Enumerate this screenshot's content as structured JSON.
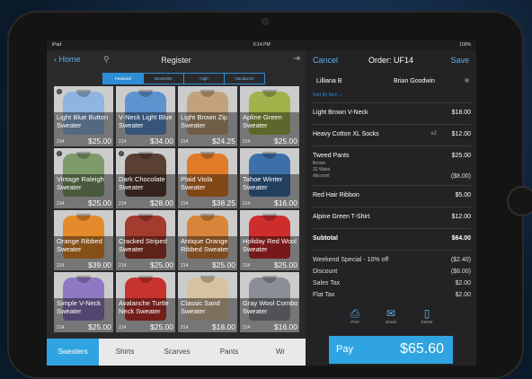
{
  "status": {
    "carrier": "iPad",
    "time": "6:14 PM",
    "battery": "100%"
  },
  "left_nav": {
    "home": "Home",
    "title": "Register"
  },
  "segments": [
    "Featured",
    "Bestseller",
    "High",
    "Handiwork"
  ],
  "products": [
    {
      "name": "Light Blue Button Sweater",
      "qty": "214",
      "price": "$25.00",
      "color": "#8fb4de",
      "info": true
    },
    {
      "name": "V-Neck Light Blue Sweater",
      "qty": "214",
      "price": "$34.00",
      "color": "#5d93cf"
    },
    {
      "name": "Light Brown Zip Sweater",
      "qty": "214",
      "price": "$24.25",
      "color": "#c2a27c"
    },
    {
      "name": "Apline Green Sweater",
      "qty": "214",
      "price": "$25.00",
      "color": "#9fb34a"
    },
    {
      "name": "Vintage Raleigh Sweater",
      "qty": "214",
      "price": "$25.00",
      "color": "#7e9a69",
      "info": true
    },
    {
      "name": "Dark Chocolate Sweater",
      "qty": "214",
      "price": "$28.00",
      "color": "#5a3f33",
      "info": true
    },
    {
      "name": "Plaid Viola Sweater",
      "qty": "214",
      "price": "$38.25",
      "color": "#e07b28"
    },
    {
      "name": "Tahoe Winter Sweater",
      "qty": "214",
      "price": "$16.00",
      "color": "#3d6fa8"
    },
    {
      "name": "Orange Ribbed Sweater",
      "qty": "214",
      "price": "$39.00",
      "color": "#e48a2a"
    },
    {
      "name": "Cracked Striped Sweater",
      "qty": "214",
      "price": "$25.00",
      "color": "#a33b2e"
    },
    {
      "name": "Antique Orange Ribbed Sweater",
      "qty": "214",
      "price": "$25.00",
      "color": "#d8843a"
    },
    {
      "name": "Holiday Red Wool Sweater",
      "qty": "214",
      "price": "$25.00",
      "color": "#cf2c2c"
    },
    {
      "name": "Simple V-Neck Sweater",
      "qty": "214",
      "price": "$25.00",
      "color": "#8e79c2"
    },
    {
      "name": "Avalanche Turtle Neck Sweater",
      "qty": "214",
      "price": "$25.00",
      "color": "#c7342e"
    },
    {
      "name": "Classic Sand Sweater",
      "qty": "214",
      "price": "$18.00",
      "color": "#d7c2a0"
    },
    {
      "name": "Gray Wool Combo Sweater",
      "qty": "214",
      "price": "$16.00",
      "color": "#8a8e96"
    }
  ],
  "categories": [
    "Sweaters",
    "Shirts",
    "Scarves",
    "Pants",
    "Wr"
  ],
  "order": {
    "cancel": "Cancel",
    "title": "Order: UF14",
    "save": "Save",
    "customer": "Lilliana B",
    "salesperson": "Brian Goodwin",
    "sort_label": "Sort By Item",
    "items": [
      {
        "name": "Light Brown V-Neck",
        "qty": "",
        "price": "$18.00"
      },
      {
        "name": "Heavy Cotton XL Socks",
        "qty": "x2",
        "price": "$12.00"
      },
      {
        "name": "Tweed Pants",
        "qty": "",
        "price": "$25.00"
      },
      {
        "name": "Red Hair Ribbon",
        "qty": "",
        "price": "$5.00"
      },
      {
        "name": "Alpine Green T-Shirt",
        "qty": "",
        "price": "$12.00"
      }
    ],
    "tweed_details": [
      "Brown",
      "32 Waist",
      "discount"
    ],
    "tweed_discount": "($8.00)",
    "subtotal_label": "Subtotal",
    "subtotal": "$64.00",
    "lines": [
      {
        "label": "Weekend Special - 10% off",
        "value": "($2.40)"
      },
      {
        "label": "Discount",
        "value": "($8.00)"
      },
      {
        "label": "Sales Tax",
        "value": "$2.00"
      },
      {
        "label": "Flat Tax",
        "value": "$2.00"
      }
    ],
    "actions": [
      "Print",
      "Email",
      "Delete"
    ],
    "pay_label": "Pay",
    "pay_total": "$65.60"
  }
}
